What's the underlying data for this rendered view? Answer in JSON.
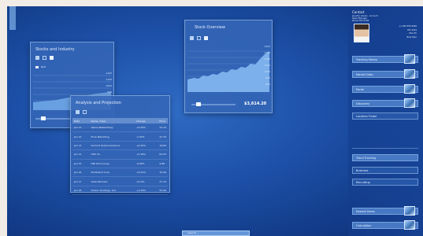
{
  "colors": {
    "desktop": "#1c4fa6",
    "window": "#3465b6",
    "panel": "#1e4a9a",
    "accent": "#e8f0ff"
  },
  "left_window": {
    "title": "Stocks and Industry",
    "legend": "NAS",
    "axis_labels": [
      "1200",
      "1100",
      "1000",
      "900",
      "800",
      "700"
    ]
  },
  "center_window": {
    "title": "Stock Overview",
    "axis_labels": [
      "1400",
      "1300",
      "1200",
      "1100",
      "1000",
      "900",
      "800"
    ],
    "value": "$3,614.20",
    "series_fill_level": 0.55
  },
  "analysis_window": {
    "title": "Analysis and Projection",
    "columns": [
      "Date",
      "Name / Desc",
      "Change",
      "Price"
    ],
    "rows": [
      [
        "Jan 11",
        "Alpine Networking",
        "+0.45%",
        "23.10"
      ],
      [
        "Jan 12",
        "Fiore Marketing",
        "-1.02%",
        "41.75"
      ],
      [
        "Jan 13",
        "Summit Global Solutions",
        "+0.30%",
        "18.60"
      ],
      [
        "Jan 14",
        "CBX Inc.",
        "+2.18%",
        "62.05"
      ],
      [
        "Jan 15",
        "DBI Tech Group",
        "-0.66%",
        "9.88"
      ],
      [
        "Jan 16",
        "Northwind Corp",
        "+0.91%",
        "33.40"
      ],
      [
        "Jan 17",
        "Vista Partners",
        "-0.12%",
        "27.15"
      ],
      [
        "Jan 18",
        "Harbor Holdings, Ltd.",
        "+1.44%",
        "55.90"
      ]
    ]
  },
  "right_panel": {
    "contact": {
      "name": "Contact",
      "lines": [
        "Jennifer Adams - Account",
        "Sales Manager",
        "Phone 555 0199"
      ],
      "numbers": [
        "+1 425 555 0180",
        "Ext 4412",
        "Mon-Fri",
        "8am-5pm"
      ]
    },
    "top_items": [
      "Tracking Stocks",
      "Market Data",
      "Portal",
      "Discovery",
      "Location Finder"
    ],
    "mid_items": [
      "Trend Tracking",
      "Business",
      "Recruiting"
    ],
    "bottom_items": [
      "Newest Items",
      "Calculation"
    ]
  },
  "taskbar": {
    "label": "Launch"
  }
}
